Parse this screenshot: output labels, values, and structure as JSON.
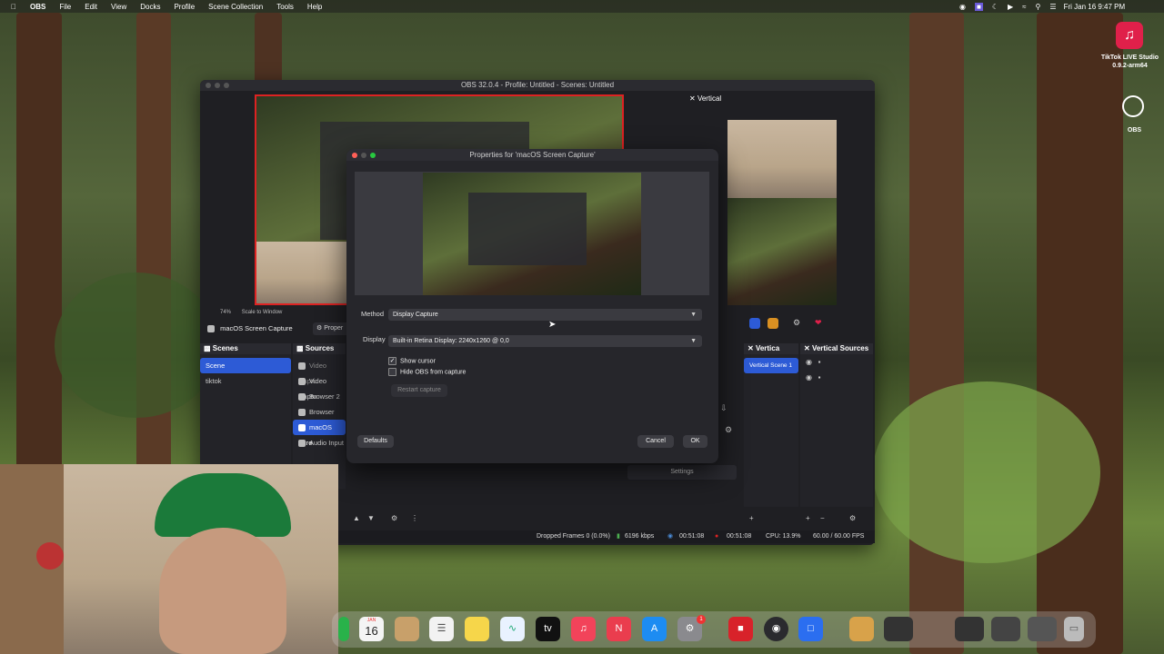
{
  "menubar": {
    "app": "OBS",
    "items": [
      "File",
      "Edit",
      "View",
      "Docks",
      "Profile",
      "Scene Collection",
      "Tools",
      "Help"
    ],
    "datetime": "Fri Jan 16  9:47 PM"
  },
  "desktop_icons": [
    {
      "label": "TikTok LIVE Studio",
      "sub": "0.9.2-arm64",
      "icon": "tiktok-icon"
    },
    {
      "label": "OBS",
      "icon": "obs-icon"
    }
  ],
  "obs_window": {
    "title": "OBS 32.0.4 - Profile: Untitled - Scenes: Untitled",
    "vertical_label": "Vertical",
    "zoom": "74%",
    "scale": "Scale to Window",
    "source_bar": {
      "source": "macOS Screen Capture",
      "properties": "Proper"
    },
    "scenes": {
      "title": "Scenes",
      "items": [
        "Scene",
        "tiktok"
      ],
      "selected": 0
    },
    "sources": {
      "title": "Sources",
      "items": [
        "Video Captu",
        "Video Captu",
        "Browser 2",
        "Browser",
        "macOS Scre",
        "Audio Input"
      ],
      "selected": 4
    },
    "vertical_scenes": {
      "title": "Vertica",
      "items": [
        "Vertical Scene 1"
      ]
    },
    "vertical_sources": {
      "title": "Vertical Sources"
    },
    "settings_label": "Settings",
    "status": {
      "dropped": "Dropped Frames 0 (0.0%)",
      "kbps": "6196 kbps",
      "rec_time": "00:51:08",
      "stream_time": "00:51:08",
      "cpu": "CPU: 13.9%",
      "fps": "60.00 / 60.00 FPS"
    }
  },
  "dialog": {
    "title": "Properties for 'macOS Screen Capture'",
    "method_label": "Method",
    "method_value": "Display Capture",
    "display_label": "Display",
    "display_value": "Built-in Retina Display: 2240x1260 @ 0,0",
    "show_cursor": "Show cursor",
    "show_cursor_checked": true,
    "hide_obs": "Hide OBS from capture",
    "hide_obs_checked": false,
    "restart": "Restart capture",
    "defaults": "Defaults",
    "cancel": "Cancel",
    "ok": "OK"
  },
  "dock": {
    "calendar_month": "JAN",
    "calendar_day": "16",
    "settings_badge": "1",
    "apps": [
      "finder-icon",
      "calendar-icon",
      "folder-icon",
      "reminders-icon",
      "notes-icon",
      "freeform-icon",
      "appletv-icon",
      "music-icon",
      "news-icon",
      "appstore-icon",
      "settings-icon",
      "photobooth-icon",
      "obs-icon",
      "tiktok-icon",
      "archive-icon",
      "trash-icon"
    ]
  },
  "colors": {
    "accent": "#2d5bd6",
    "tiktok": "#e0204a",
    "record": "#d22"
  }
}
